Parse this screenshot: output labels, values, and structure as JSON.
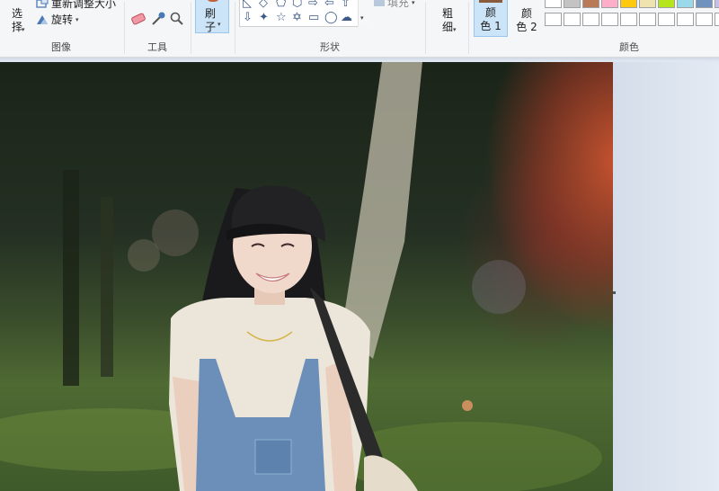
{
  "ribbon": {
    "image_group": {
      "label": "图像",
      "select_label": "选\n择",
      "resize_label": "重新调整大小",
      "rotate_label": "旋转"
    },
    "tools_group": {
      "label": "工具"
    },
    "brush": {
      "label": "刷\n子"
    },
    "shapes_group": {
      "label": "形状",
      "fill_label": "填充"
    },
    "size": {
      "label": "粗\n细"
    },
    "colors_group": {
      "label": "颜色",
      "color1_label": "颜\n色 1",
      "color2_label": "颜\n色 2",
      "color1_value": "#8a5a3a",
      "palette_top": [
        "#ffffff",
        "#c3c3c3",
        "#b97a57",
        "#ffaec9",
        "#ffc90e",
        "#efe4b0",
        "#b5e61d",
        "#99d9ea",
        "#7092be",
        "#c8bfe7"
      ],
      "palette_bottom": [
        "#ffffff",
        "#ffffff",
        "#ffffff",
        "#ffffff",
        "#ffffff",
        "#ffffff",
        "#ffffff",
        "#ffffff",
        "#ffffff",
        "#ffffff"
      ]
    }
  },
  "colors": {
    "ribbon_bg": "#f5f6f7",
    "selected_bg": "#cce4f7",
    "selected_border": "#9ac6ec",
    "workspace_bg": "#dfe8f3"
  }
}
